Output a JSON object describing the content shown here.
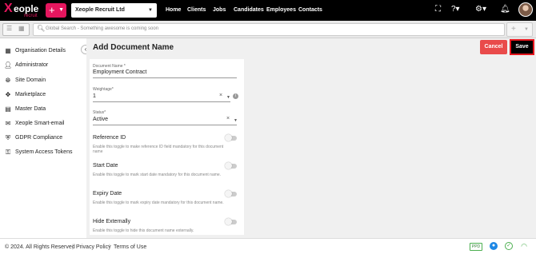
{
  "topbar": {
    "logo_mark": "X",
    "logo_word": "eople",
    "logo_sub": "recruit",
    "quick_add_label": "+",
    "company_selector": "Xeople Recruit Ltd",
    "nav": [
      "Home",
      "Clients",
      "Jobs",
      "Candidates",
      "Employees",
      "Contacts"
    ]
  },
  "search": {
    "placeholder": "Global Search - Something awesome is coming soon",
    "add_label": "+"
  },
  "sidebar": {
    "items": [
      {
        "label": "Organisation Details",
        "icon": "building-icon"
      },
      {
        "label": "Administrator",
        "icon": "user-icon"
      },
      {
        "label": "Site Domain",
        "icon": "globe-icon"
      },
      {
        "label": "Marketplace",
        "icon": "marketplace-icon"
      },
      {
        "label": "Master Data",
        "icon": "database-icon"
      },
      {
        "label": "Xeople Smart-email",
        "icon": "email-icon"
      },
      {
        "label": "GDPR Compliance",
        "icon": "shield-icon"
      },
      {
        "label": "System Access Tokens",
        "icon": "key-icon"
      }
    ]
  },
  "page": {
    "title": "Add Document Name",
    "cancel_label": "Cancel",
    "save_label": "Save"
  },
  "form": {
    "document_name": {
      "label": "Document Name *",
      "value": "Employment Contract"
    },
    "weightage": {
      "label": "Weightage*",
      "value": "1"
    },
    "status": {
      "label": "Status*",
      "value": "Active"
    },
    "toggles": [
      {
        "label": "Reference ID",
        "description": "Enable this toggle to make reference ID field mandatory for this document name",
        "on": false
      },
      {
        "label": "Start Date",
        "description": "Enable this toggle to mark start date mandatory for this document name.",
        "on": false
      },
      {
        "label": "Expiry Date",
        "description": "Enable this toggle to mark expiry date mandatory for this document name.",
        "on": false
      },
      {
        "label": "Hide Externally",
        "description": "Enable this toggle to hide this document name externally.",
        "on": false
      }
    ]
  },
  "footer": {
    "copyright": "© 2024. All Rights Reserved",
    "privacy": "Privacy Policy",
    "terms": "Terms of Use",
    "separator": "|",
    "badge": "PPD"
  },
  "colors": {
    "brand": "#e5165e",
    "topbar": "#000000",
    "cancel": "#e94b4b",
    "save_highlight": "#e5161e"
  }
}
